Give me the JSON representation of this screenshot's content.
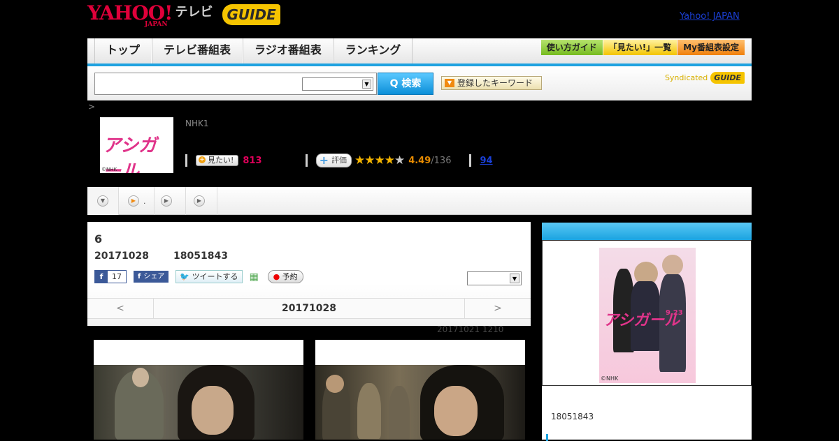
{
  "header": {
    "yahoo_logo": "YAHOO!",
    "yahoo_sub": "JAPAN",
    "tv_label": "テレビ",
    "gguide_logo": "GUIDE",
    "yahoo_japan_link": "Yahoo! JAPAN"
  },
  "nav": {
    "tabs": [
      {
        "label": "トップ"
      },
      {
        "label": "テレビ番組表"
      },
      {
        "label": "ラジオ番組表"
      },
      {
        "label": "ランキング"
      }
    ],
    "buttons": [
      {
        "label": "使い方ガイド"
      },
      {
        "label": "「見たい!」一覧"
      },
      {
        "label": "My番組表設定"
      }
    ]
  },
  "search": {
    "placeholder": "",
    "button_label": "Q 検索",
    "keyword_button": "登録したキーワード",
    "syndicated": "Syndicated",
    "syndicated_logo": "GUIDE"
  },
  "breadcrumb": ">",
  "program": {
    "thumb_title": "アシガール",
    "thumb_copyright": "©NHK",
    "channel": "NHK1",
    "mitai_label": "見たい!",
    "mitai_count": "813",
    "eval_label": "評価",
    "stars_full": "★★★★",
    "stars_empty": "★",
    "rating": "4.49",
    "rating_count": "/136",
    "reviews": "94"
  },
  "tabs": [
    {
      "icon": "chevron-down-icon",
      "label": ""
    },
    {
      "icon": "play-icon",
      "label": "."
    },
    {
      "icon": "play-icon",
      "label": ""
    },
    {
      "icon": "play-icon",
      "label": ""
    }
  ],
  "episode": {
    "number": "6",
    "date": "20171028",
    "id": "18051843",
    "fb_count": "17",
    "fb_share": "シェア",
    "tweet": "ツイートする",
    "reserve": "予約",
    "pager_prev": "<",
    "pager_date": "20171028",
    "pager_next": ">",
    "updated": "20171021  1210"
  },
  "sidebar": {
    "poster_title": "アシガール",
    "poster_date": "9.23",
    "poster_copyright": "©NHK",
    "id": "18051843"
  }
}
